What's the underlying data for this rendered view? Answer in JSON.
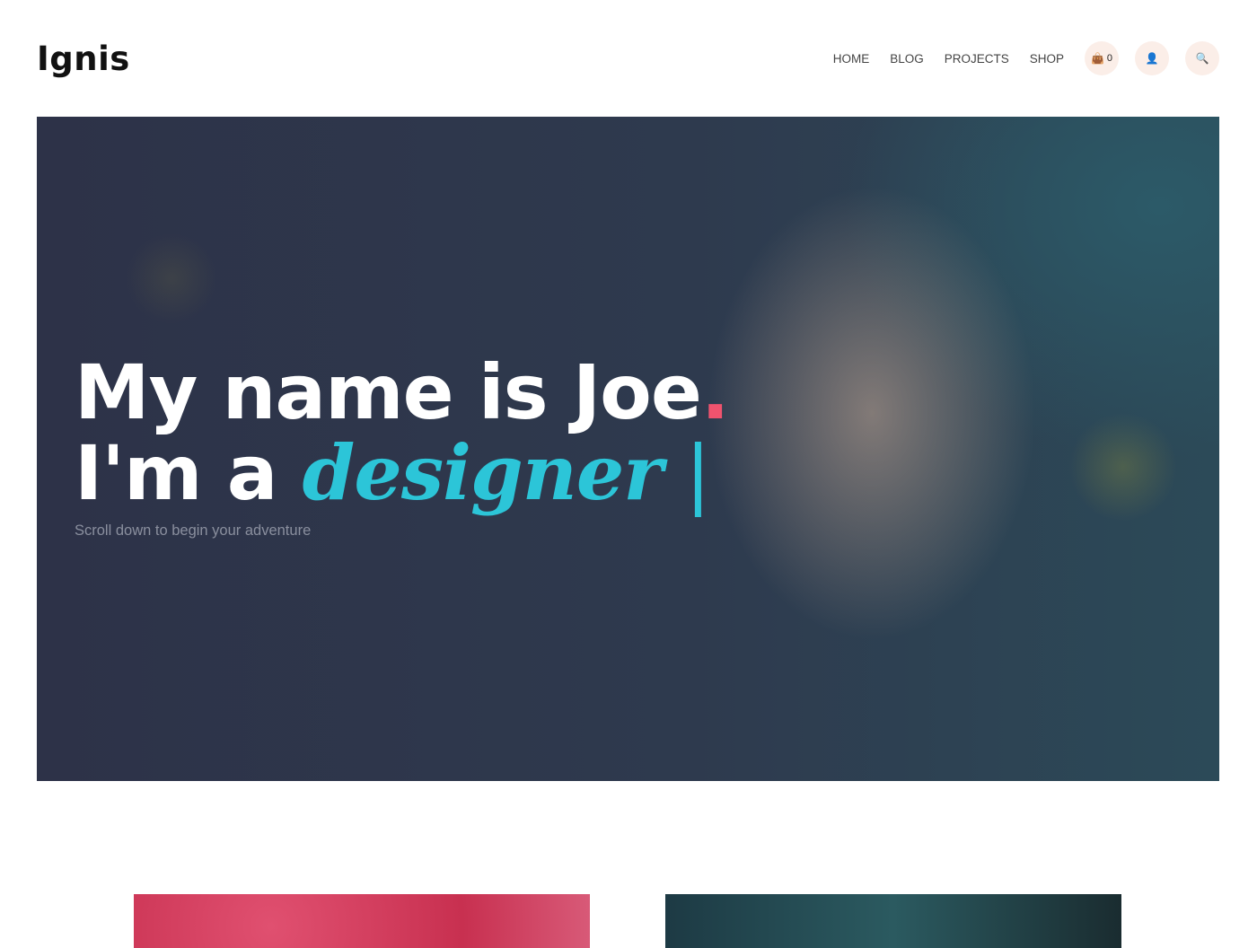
{
  "brand": "Ignis",
  "nav": {
    "items": [
      "HOME",
      "BLOG",
      "PROJECTS",
      "SHOP"
    ],
    "cart_count": "0"
  },
  "hero": {
    "line1": "My name is Joe",
    "dot": ".",
    "line2_prefix": "I'm a ",
    "role": "designer",
    "cursor": " |",
    "subtitle": "Scroll down to begin your adventure"
  }
}
